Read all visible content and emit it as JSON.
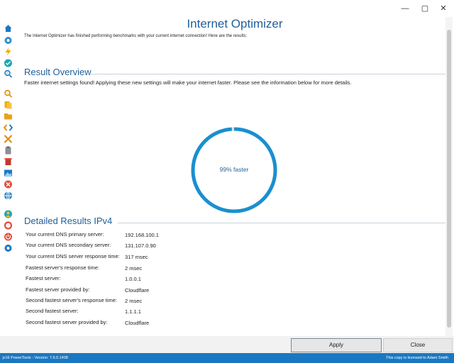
{
  "window": {
    "title": "Internet Optimizer",
    "controls": {
      "minimize": "—",
      "maximize": "▢",
      "close": "✕"
    }
  },
  "intro_text": "The Internet Optimizer has finished performing benchmarks with your current internet connection! Here are the results:",
  "result_overview": {
    "heading": "Result Overview",
    "description": "Faster internet settings found! Applying these new settings will make your internet faster. Please see the information below for more details.",
    "gauge_label": "99% faster",
    "gauge_value": 0.99,
    "gauge_color": "#1a8fd0"
  },
  "detailed": {
    "heading": "Detailed Results IPv4",
    "rows": [
      {
        "label": "Your current DNS primary server:",
        "value": "192.168.100.1"
      },
      {
        "label": "Your current DNS secondary server:",
        "value": "131.107.0.90"
      },
      {
        "label": "Your current DNS server response time:",
        "value": "317 msec"
      },
      {
        "label": "Fastest server's response time:",
        "value": "2 msec"
      },
      {
        "label": "Fastest server:",
        "value": "1.0.0.1"
      },
      {
        "label": "Fastest server provided by:",
        "value": "Cloudflare"
      },
      {
        "label": "Second fastest server's response time:",
        "value": "2 msec"
      },
      {
        "label": "Second fastest server:",
        "value": "1.1.1.1"
      },
      {
        "label": "Second fastest server provided by:",
        "value": "Cloudflare"
      }
    ]
  },
  "buttons": {
    "apply": "Apply",
    "close": "Close"
  },
  "status": {
    "left": " jv16 PowerTools - Version: 7.6.0.1408",
    "right": "This copy is licensed to Adam Smith"
  },
  "sidebar_icons": [
    "home-icon",
    "settings-gear-icon",
    "lightning-icon",
    "checkmark-icon",
    "search-icon",
    "search-icon",
    "documents-icon",
    "folder-icon",
    "code-icon",
    "cross-arrows-icon",
    "clipboard-icon",
    "delete-icon",
    "image-icon",
    "block-icon",
    "globe-icon",
    "user-icon",
    "lifebuoy-icon",
    "power-icon",
    "gear-icon"
  ]
}
